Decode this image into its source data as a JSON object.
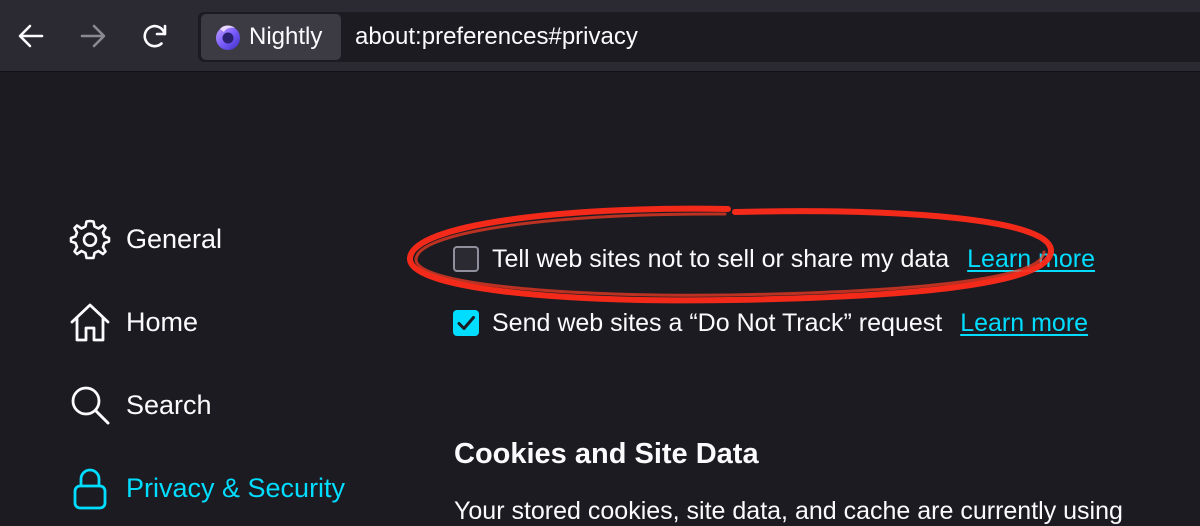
{
  "browser": {
    "back_icon": "arrow-left-icon",
    "forward_icon": "arrow-right-icon",
    "reload_icon": "reload-icon",
    "identity_label": "Nightly",
    "url": "about:preferences#privacy"
  },
  "sidebar": {
    "items": [
      {
        "label": "General",
        "icon": "gear-icon"
      },
      {
        "label": "Home",
        "icon": "home-icon"
      },
      {
        "label": "Search",
        "icon": "search-icon"
      },
      {
        "label": "Privacy & Security",
        "icon": "lock-icon",
        "selected": true
      }
    ]
  },
  "main": {
    "prefs": [
      {
        "label": "Tell web sites not to sell or share my data",
        "checked": false,
        "link": "Learn more"
      },
      {
        "label": "Send web sites a “Do Not Track” request",
        "checked": true,
        "link": "Learn more"
      }
    ],
    "section_title": "Cookies and Site Data",
    "section_text": "Your stored cookies, site data, and cache are currently using"
  },
  "colors": {
    "background": "#1c1b22",
    "toolbar": "#2b2a33",
    "accent": "#00ddff",
    "annotation": "#ff2a1a"
  }
}
